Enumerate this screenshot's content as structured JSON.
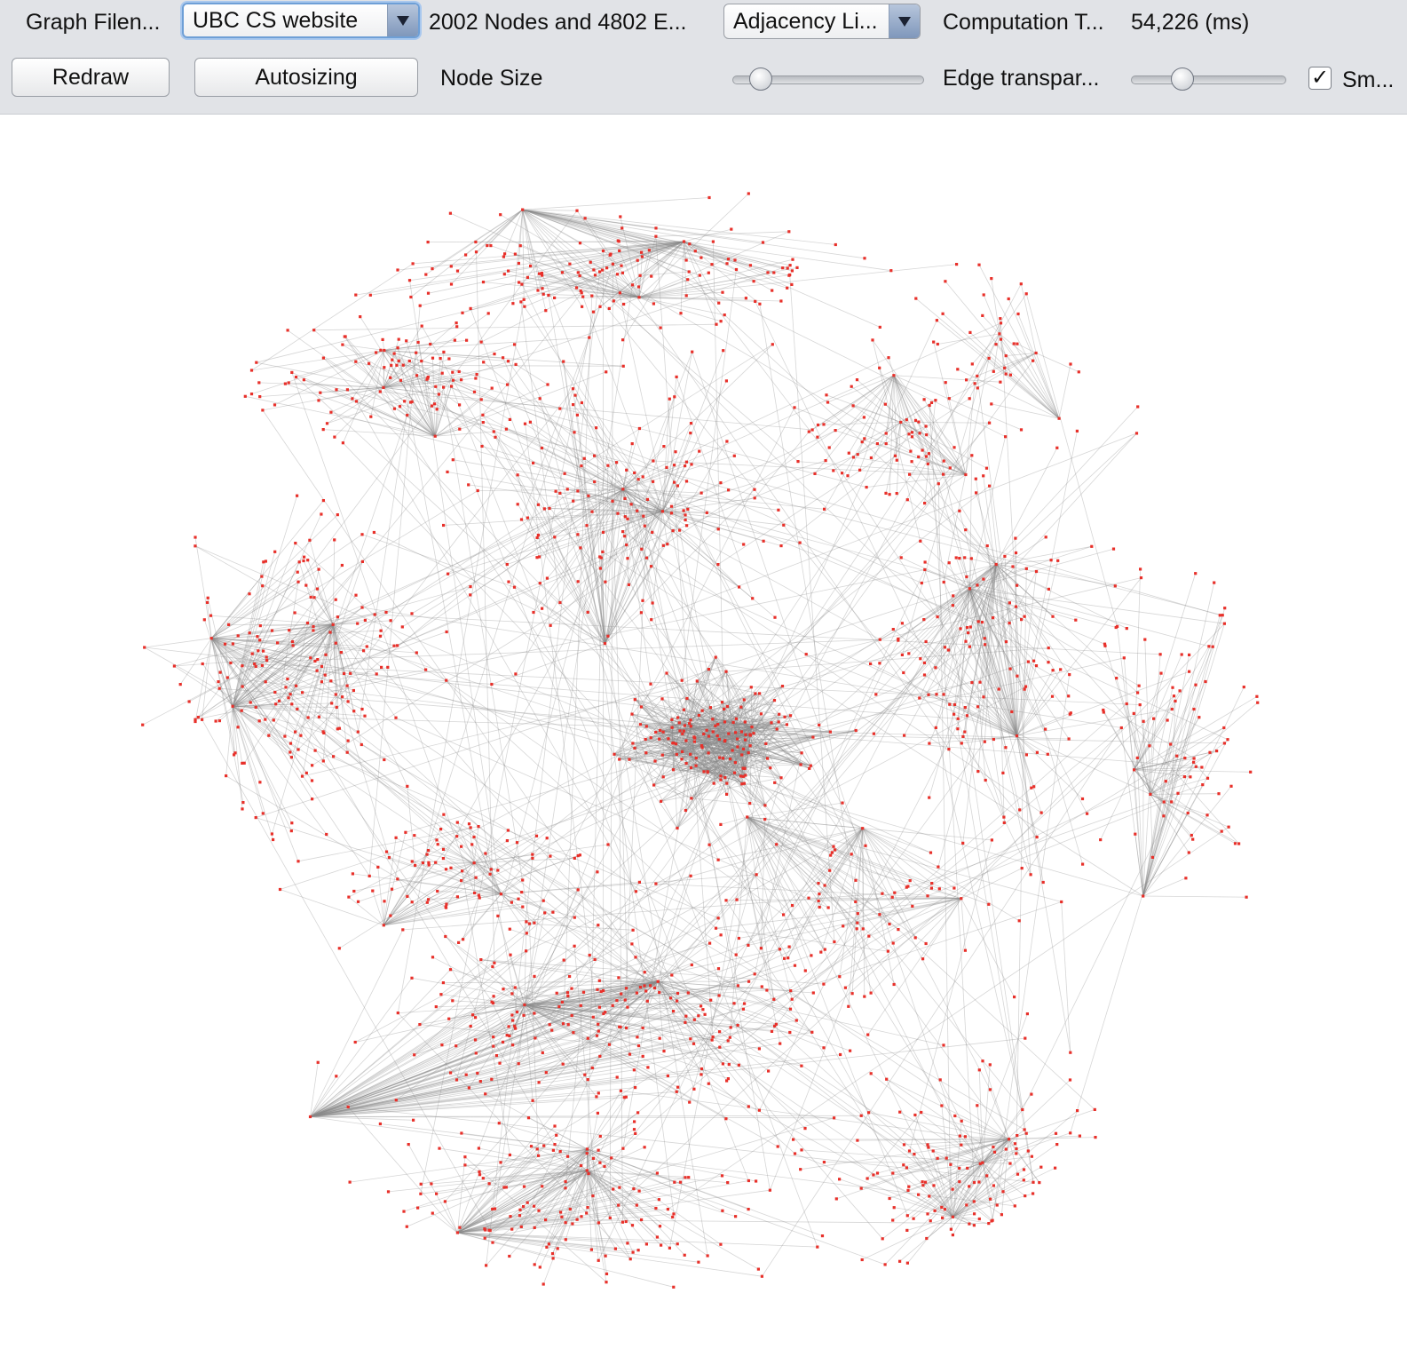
{
  "toolbar": {
    "graph_file_label": "Graph Filen...",
    "graph_file_value": "UBC CS website",
    "stats_text": "2002 Nodes and 4802 E...",
    "layout_value": "Adjacency Li...",
    "computation_label": "Computation T...",
    "computation_value": "54,226 (ms)",
    "redraw_label": "Redraw",
    "autosizing_label": "Autosizing",
    "node_size_label": "Node Size",
    "node_size_level": 0.1,
    "edge_transparency_label": "Edge transpar...",
    "edge_transparency_level": 0.3,
    "smooth_label": "Sm...",
    "smooth_checked": true,
    "check_mark": "✓"
  },
  "graph": {
    "node_color": "#e8302a",
    "edge_color": "#8a8a8a",
    "node_count": 2002,
    "edge_count": 4802
  },
  "icons": {
    "combo_arrow": "chevron-down-icon",
    "checkbox": "checkmark-icon"
  }
}
